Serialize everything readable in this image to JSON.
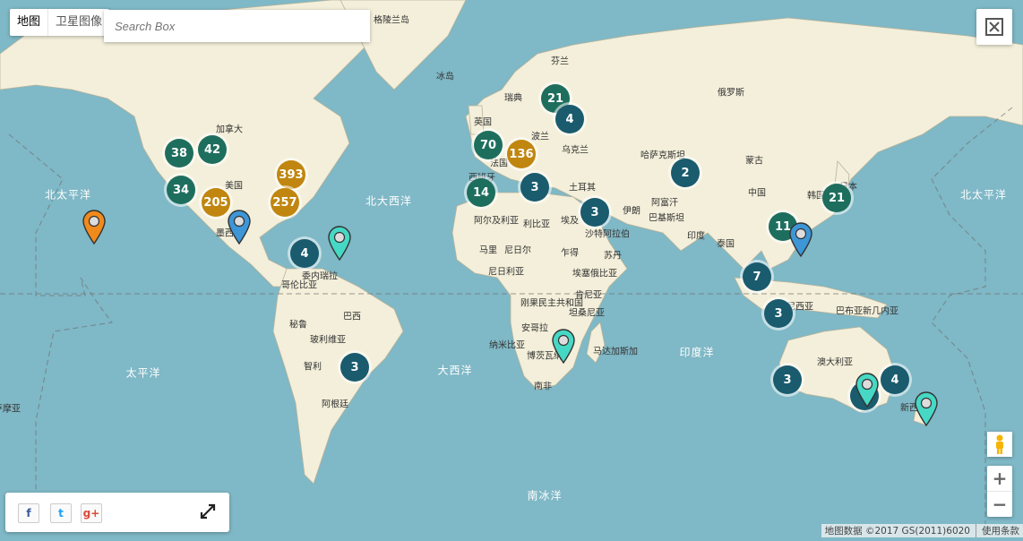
{
  "controls": {
    "map_type": [
      "地图",
      "卫星图像"
    ],
    "search_placeholder": "Search Box",
    "zoom_in": "+",
    "zoom_out": "−"
  },
  "share": {
    "facebook": "f",
    "twitter": "t",
    "google_plus": "g+"
  },
  "attribution": {
    "data": "地图数据 ©2017 GS(2011)6020",
    "terms": "使用条款"
  },
  "oceans": {
    "north_pacific_left": "北太平洋",
    "north_atlantic": "北大西洋",
    "north_pacific_right": "北太平洋",
    "pacific": "太平洋",
    "atlantic": "大西洋",
    "indian": "印度洋",
    "southern": "南冰洋"
  },
  "countries": [
    "格陵兰岛",
    "芬兰",
    "冰岛",
    "瑞典",
    "俄罗斯",
    "加拿大",
    "英国",
    "波兰",
    "乌克兰",
    "哈萨克斯坦",
    "蒙古",
    "法国",
    "美国",
    "西班牙",
    "土耳其",
    "中国",
    "日本",
    "韩国",
    "伊朗",
    "阿富汗",
    "巴基斯坦",
    "阿尔及利亚",
    "利比亚",
    "埃及",
    "沙特阿拉伯",
    "印度",
    "泰国",
    "墨西哥",
    "马里",
    "尼日尔",
    "乍得",
    "苏丹",
    "尼日利亚",
    "埃塞俄比亚",
    "委内瑞拉",
    "哥伦比亚",
    "刚果民主共和国",
    "肯尼亚",
    "坦桑尼亚",
    "秘鲁",
    "巴西",
    "安哥拉",
    "玻利维亚",
    "纳米比亚",
    "博茨瓦纳",
    "马达加斯加",
    "智利",
    "南非",
    "阿根廷",
    "巴布亚新几内亚",
    "印度尼西亚",
    "澳大利亚",
    "新西兰",
    "萨摩亚"
  ],
  "clusters": [
    {
      "value": "38",
      "color": "#1e6e5e"
    },
    {
      "value": "42",
      "color": "#1e6e5e"
    },
    {
      "value": "34",
      "color": "#1e6e5e"
    },
    {
      "value": "205",
      "color": "#c0860f"
    },
    {
      "value": "393",
      "color": "#c0860f"
    },
    {
      "value": "257",
      "color": "#c0860f"
    },
    {
      "value": "4",
      "color": "#1a5b6e"
    },
    {
      "value": "21",
      "color": "#1e6e5e"
    },
    {
      "value": "4",
      "color": "#1a5b6e"
    },
    {
      "value": "70",
      "color": "#1e6e5e"
    },
    {
      "value": "136",
      "color": "#c0860f"
    },
    {
      "value": "14",
      "color": "#1e6e5e"
    },
    {
      "value": "3",
      "color": "#1a5b6e"
    },
    {
      "value": "3",
      "color": "#1a5b6e"
    },
    {
      "value": "2",
      "color": "#1a5b6e"
    },
    {
      "value": "21",
      "color": "#1e6e5e"
    },
    {
      "value": "11",
      "color": "#1e6e5e"
    },
    {
      "value": "7",
      "color": "#1a5b6e"
    },
    {
      "value": "3",
      "color": "#1a5b6e"
    },
    {
      "value": "3",
      "color": "#1a5b6e"
    },
    {
      "value": "3",
      "color": "#1a5b6e"
    },
    {
      "value": "4",
      "color": "#1a5b6e"
    },
    {
      "value": "6",
      "color": "#1a5b6e"
    }
  ],
  "pins": [
    {
      "color": "#f08a1c"
    },
    {
      "color": "#3d96d6"
    },
    {
      "color": "#46d8c4"
    },
    {
      "color": "#46d8c4"
    },
    {
      "color": "#3d96d6"
    },
    {
      "color": "#46d8c4"
    },
    {
      "color": "#46d8c4"
    }
  ]
}
